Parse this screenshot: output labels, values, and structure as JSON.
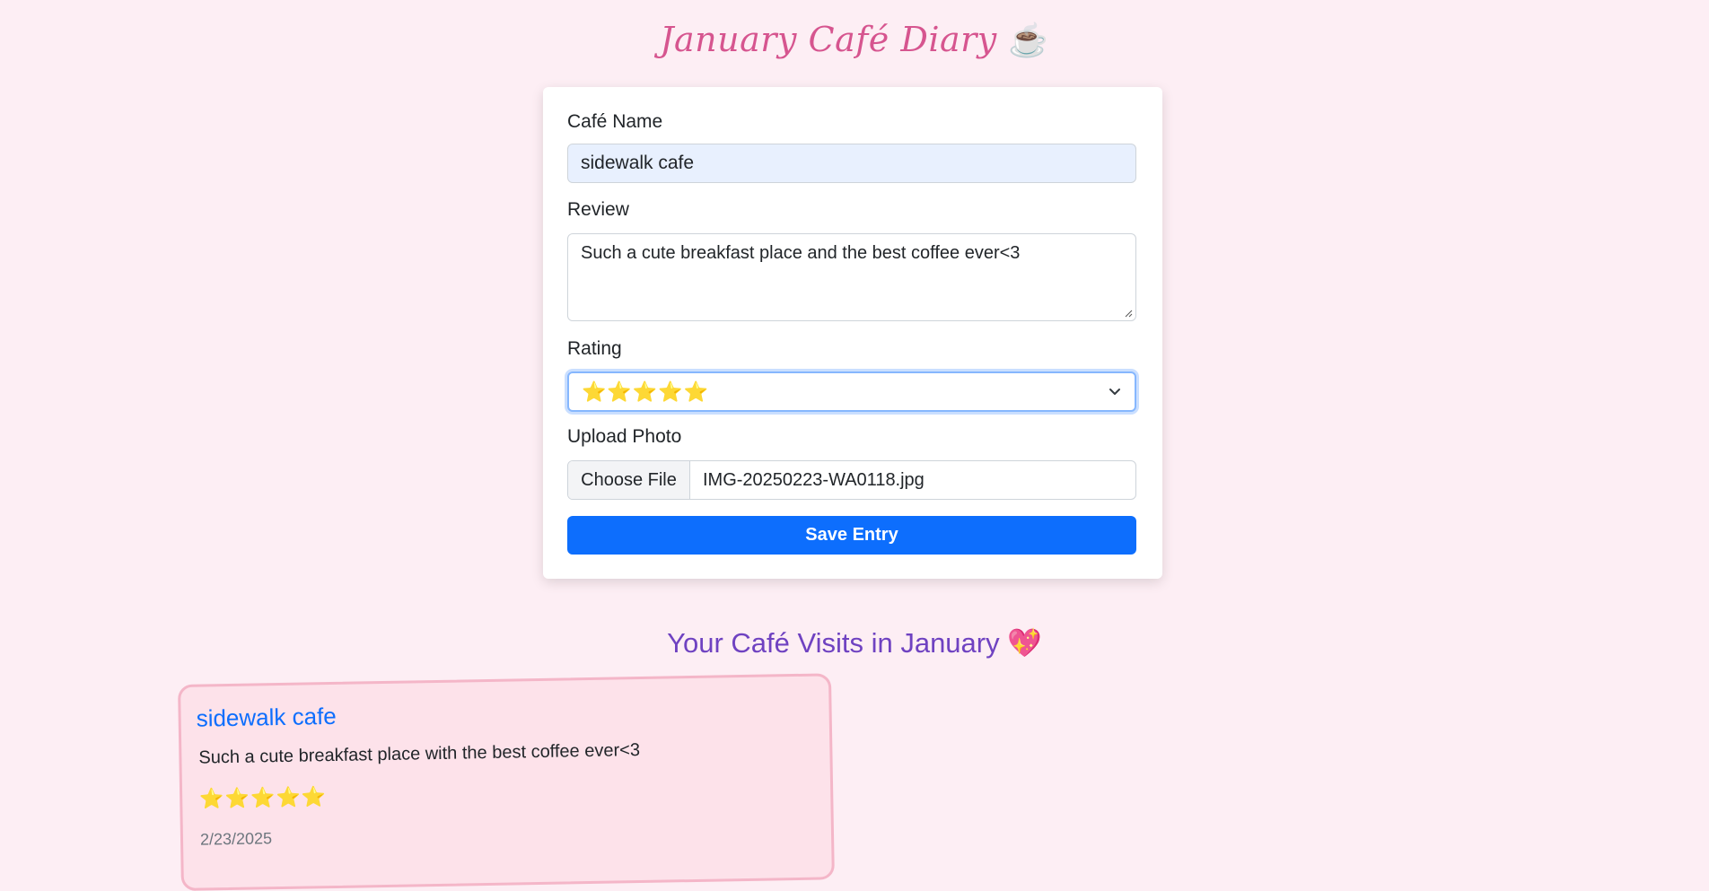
{
  "page": {
    "title": "January Café Diary",
    "title_icon": "☕",
    "section_heading": "Your Café Visits in January",
    "section_icon": "💖"
  },
  "form": {
    "cafe_name_label": "Café Name",
    "cafe_name_value": "sidewalk cafe",
    "review_label": "Review",
    "review_value": "Such a cute breakfast place and the best coffee ever<3",
    "rating_label": "Rating",
    "rating_value": "⭐⭐⭐⭐⭐",
    "rating_stars": 5,
    "upload_label": "Upload Photo",
    "choose_file_label": "Choose File",
    "file_name": "IMG-20250223-WA0118.jpg",
    "save_label": "Save Entry"
  },
  "entries": [
    {
      "name": "sidewalk cafe",
      "review": "Such a cute breakfast place with the best coffee ever<3",
      "stars": "⭐⭐⭐⭐⭐",
      "rating": 5,
      "date": "2/23/2025"
    }
  ],
  "colors": {
    "background": "#fdeef4",
    "title": "#d6558f",
    "heading": "#6f42c1",
    "primary": "#0d6efd",
    "card": "#fde2ea",
    "card_border": "#f4b6c8"
  }
}
